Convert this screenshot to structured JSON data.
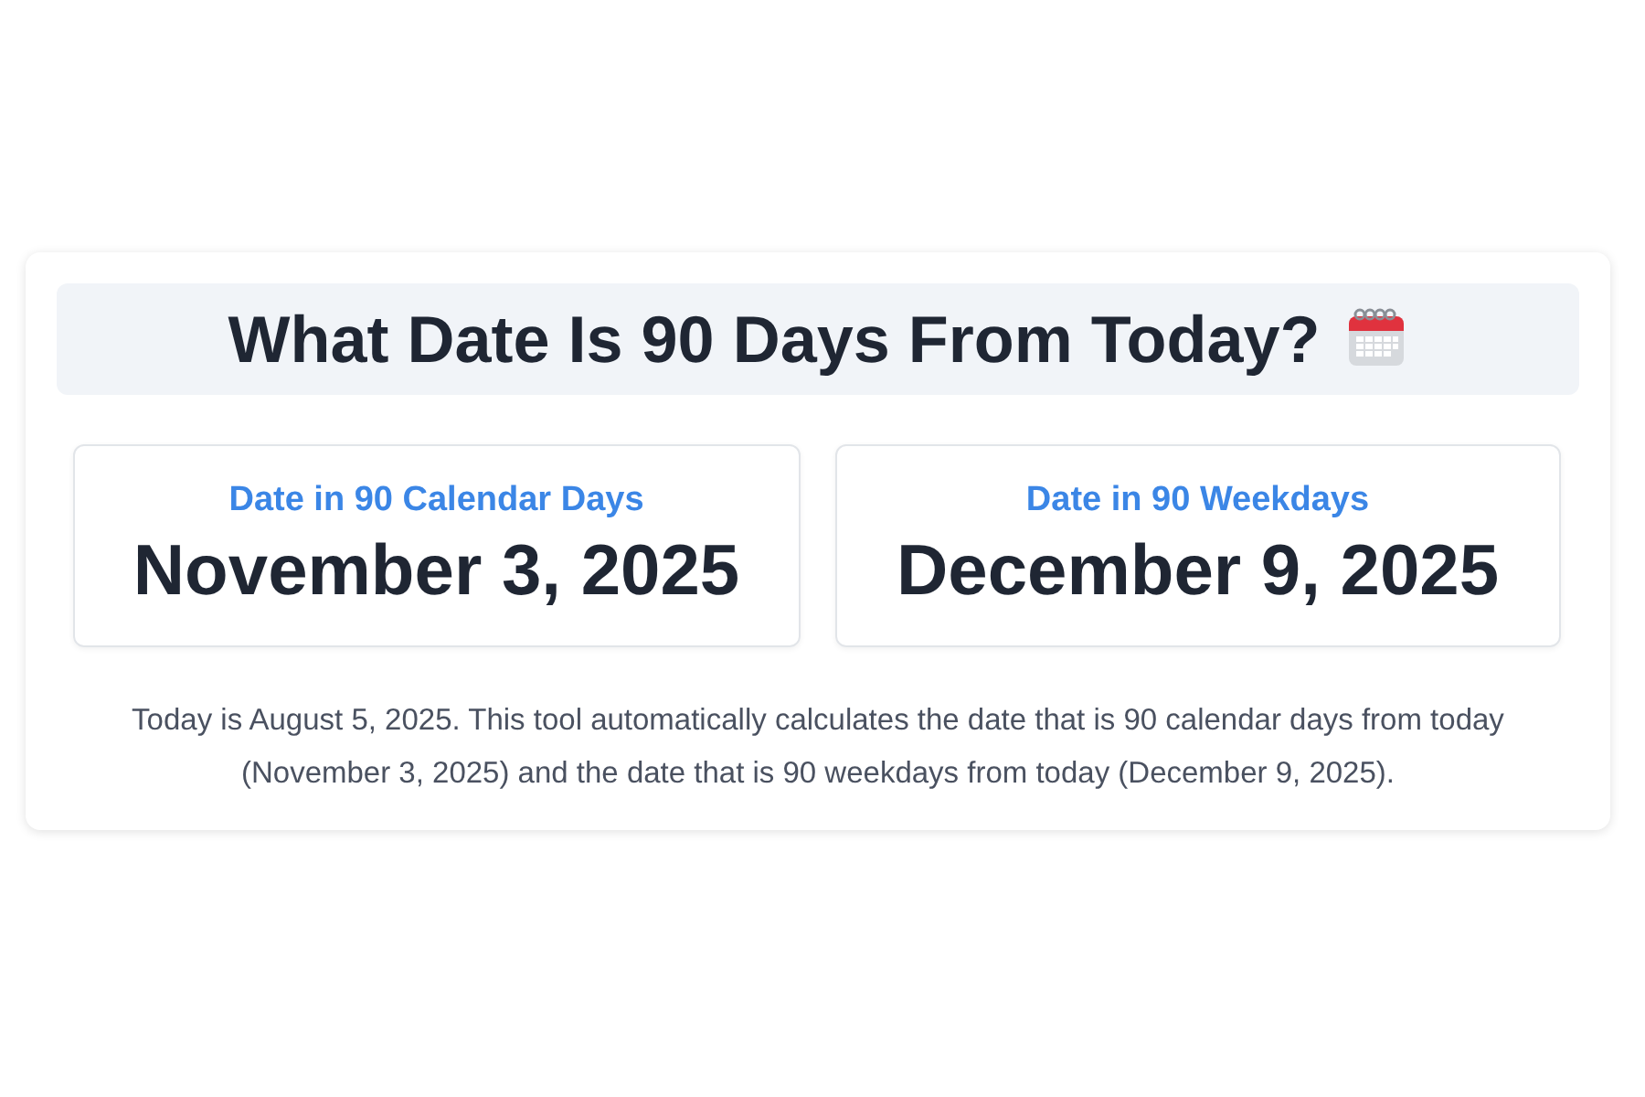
{
  "title": "What Date Is 90 Days From Today?",
  "results": [
    {
      "label": "Date in 90 Calendar Days",
      "date": "November 3, 2025"
    },
    {
      "label": "Date in 90 Weekdays",
      "date": "December 9, 2025"
    }
  ],
  "description": "Today is August 5, 2025. This tool automatically calculates the date that is 90 calendar days from today (November 3, 2025) and the date that is 90 weekdays from today (December 9, 2025)."
}
